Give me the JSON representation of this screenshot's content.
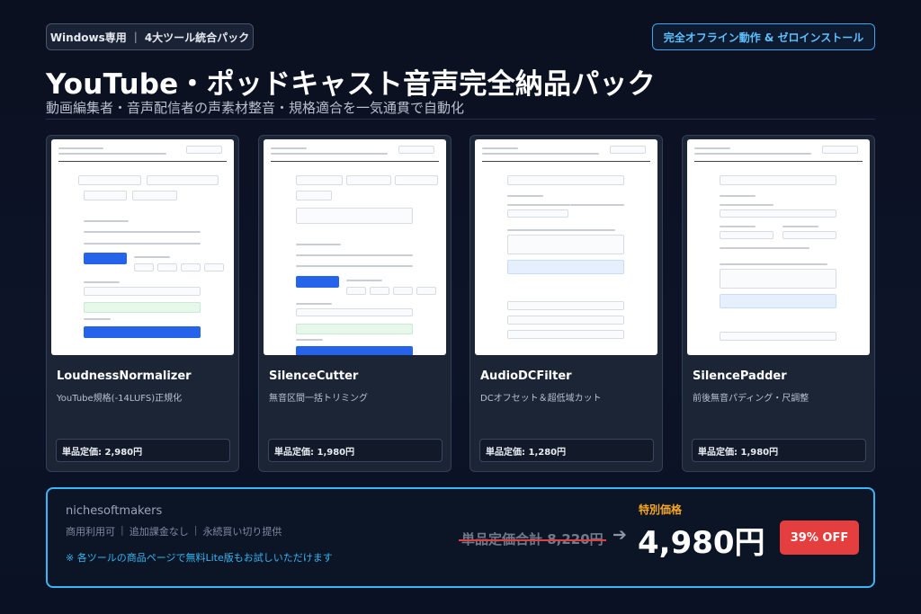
{
  "header": {
    "badge_platform": "Windows専用",
    "badge_separator": "|",
    "badge_pack": "4大ツール統合パック",
    "offline_badge": "完全オフライン動作 & ゼロインストール",
    "title": "YouTube・ポッドキャスト音声完全納品パック",
    "subtitle": "動画編集者・音声配信者の声素材整音・規格適合を一気通貫で自動化"
  },
  "products": [
    {
      "name": "LoudnessNormalizer",
      "description": "YouTube規格(-14LUFS)正規化",
      "price": "単品定価: 2,980円"
    },
    {
      "name": "SilenceCutter",
      "description": "無音区間一括トリミング",
      "price": "単品定価: 1,980円"
    },
    {
      "name": "AudioDCFilter",
      "description": "DCオフセット＆超低域カット",
      "price": "単品定価: 1,280円"
    },
    {
      "name": "SilencePadder",
      "description": "前後無音パディング・尺調整",
      "price": "単品定価: 1,980円"
    }
  ],
  "offer": {
    "brand": "nichesoftmakers",
    "features": [
      "商用利用可",
      "追加課金なし",
      "永続買い切り提供"
    ],
    "feature_separator": "|",
    "lite_note": "※ 各ツールの商品ページで無料Lite版もお試しいただけます",
    "special_label": "特別価格",
    "old_price": "単品定価合計 8,220円",
    "arrow": "➔",
    "new_price": "4,980円",
    "discount": "39% OFF"
  },
  "colors": {
    "accent_blue": "#38b6f5",
    "special_orange": "#f5a623",
    "discount_red": "#e53e3e",
    "background": "#0b1020"
  }
}
